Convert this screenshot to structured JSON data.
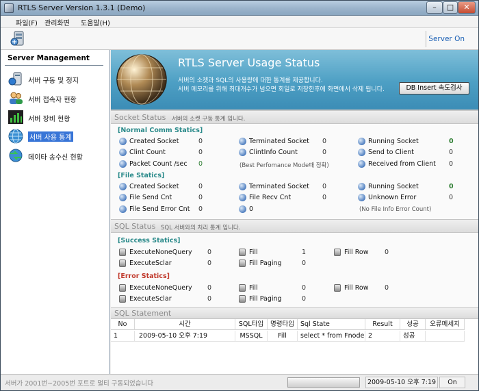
{
  "window": {
    "title": "RTLS Server Version 1.3.1 (Demo)",
    "minimize": "–",
    "maximize": "□",
    "close": "✕"
  },
  "menu": [
    "파일(F)",
    "관리화면",
    "도움말(H)"
  ],
  "toolbar": {
    "status": "Server On"
  },
  "sidebar": {
    "title": "Server Management",
    "items": [
      {
        "label": "서버 구동 및 정지",
        "icon": "server-start-icon"
      },
      {
        "label": "서버 접속자 현황",
        "icon": "users-icon"
      },
      {
        "label": "서버 장비 현황",
        "icon": "device-chart-icon"
      },
      {
        "label": "서버 사용 통계",
        "icon": "globe-icon",
        "selected": true
      },
      {
        "label": "데이타 송수신 현황",
        "icon": "transfer-icon"
      }
    ]
  },
  "banner": {
    "title": "RTLS Server Usage Status",
    "desc1": "서버의 소켓과 SQL의 사용량에 대한 통계를 제공합니다.",
    "desc2": "서버 메모리를 위해 최대개수가 넘으면 회일로 저장한후에 화면에서 삭제 됩니다.",
    "db_button": "DB Insert 속도검사"
  },
  "socket_status": {
    "title": "Socket Status",
    "subtitle": "서버의 소켓 구동 통계 입니다.",
    "normal": {
      "title": "[Normal Comm Statics]",
      "items": [
        {
          "label": "Created Socket",
          "value": "0"
        },
        {
          "label": "Terminated Socket",
          "value": "0"
        },
        {
          "label": "Running Socket",
          "value": "0"
        },
        {
          "label": "Clint Count",
          "value": "0"
        },
        {
          "label": "ClintInfo Count",
          "value": "0"
        },
        {
          "label": "Send to Client",
          "value": "0"
        },
        {
          "label": "Packet Count /sec",
          "value": "0"
        },
        {
          "label": "Received from Client",
          "value": "0"
        }
      ],
      "note": "(Best Perfomance Mode때 정확)"
    },
    "file": {
      "title": "[File Statics]",
      "items": [
        {
          "label": "Created Socket",
          "value": "0"
        },
        {
          "label": "Terminated Socket",
          "value": "0"
        },
        {
          "label": "Running Socket",
          "value": "0"
        },
        {
          "label": "File Send Cnt",
          "value": "0"
        },
        {
          "label": "File Recv Cnt",
          "value": "0"
        },
        {
          "label": "Unknown Error",
          "value": "0"
        },
        {
          "label": "File Send Error Cnt",
          "value": "0"
        },
        {
          "label": "0",
          "value": "0"
        }
      ],
      "note": "(No File Info Error Count)"
    }
  },
  "sql_status": {
    "title": "SQL Status",
    "subtitle": "SQL 서버와의 처리 통계 입니다.",
    "success": {
      "title": "[Success Statics]",
      "items": [
        {
          "label": "ExecuteNoneQuery",
          "value": "0"
        },
        {
          "label": "Fill",
          "value": "1"
        },
        {
          "label": "Fill Row",
          "value": "0"
        },
        {
          "label": "ExecuteSclar",
          "value": "0"
        },
        {
          "label": "Fill Paging",
          "value": "0"
        }
      ]
    },
    "error": {
      "title": "[Error Statics]",
      "items": [
        {
          "label": "ExecuteNoneQuery",
          "value": "0"
        },
        {
          "label": "Fill",
          "value": "0"
        },
        {
          "label": "Fill Row",
          "value": "0"
        },
        {
          "label": "ExecuteSclar",
          "value": "0"
        },
        {
          "label": "Fill Paging",
          "value": "0"
        }
      ]
    }
  },
  "sql_statement": {
    "title": "SQL Statement",
    "columns": [
      "No",
      "시간",
      "SQL타입",
      "명령타입",
      "Sql State",
      "Result",
      "성공",
      "오류메세지"
    ],
    "rows": [
      [
        "1",
        "2009-05-10 오후 7:19",
        "MSSQL",
        "Fill",
        "select * from FnodeData",
        "2",
        "성공",
        ""
      ]
    ]
  },
  "statusbar": {
    "message": "서버가 2001번~2005번 포트로 멀티 구동되었습니다",
    "datetime": "2009-05-10 오후 7:19",
    "state": "On"
  },
  "colors": {
    "banner": "#4d9fc4",
    "group_title": "#2a8a8a",
    "error_title": "#c0392b",
    "selected": "#3875d7"
  }
}
